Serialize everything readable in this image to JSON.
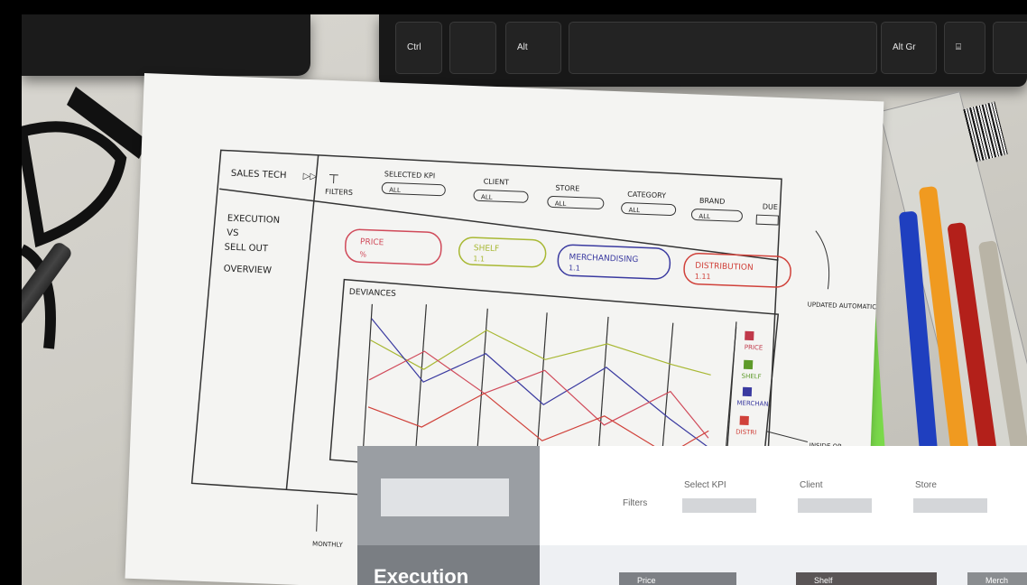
{
  "keyboard": {
    "keys": [
      "Ctrl",
      "Alt",
      "Alt Gr",
      "⌸"
    ]
  },
  "sketch": {
    "app_title": "SALES TECH",
    "filters_label": "FILTERS",
    "filters": [
      {
        "label": "SELECTED KPI",
        "value": "ALL"
      },
      {
        "label": "CLIENT",
        "value": "ALL"
      },
      {
        "label": "STORE",
        "value": "ALL"
      },
      {
        "label": "CATEGORY",
        "value": "ALL"
      },
      {
        "label": "BRAND",
        "value": "ALL"
      },
      {
        "label": "DUE",
        "value": ""
      }
    ],
    "nav": {
      "line1": "EXECUTION",
      "line2": "VS",
      "line3": "SELL OUT",
      "overview": "OVERVIEW"
    },
    "kpi_cards": [
      {
        "label": "PRICE",
        "sub": "%",
        "color": "#d04a5a"
      },
      {
        "label": "SHELF",
        "sub": "1.1",
        "color": "#a8b833"
      },
      {
        "label": "MERCHANDISING",
        "sub": "1.1",
        "color": "#3a3aa0"
      },
      {
        "label": "DISTRIBUTION",
        "sub": "1.11",
        "color": "#d0413a"
      }
    ],
    "chart_title": "DEVIANCES",
    "legend": [
      "PRICE",
      "SHELF",
      "MERCHAN",
      "DISTRI"
    ],
    "note_right": "UPDATED AUTOMATICALLY",
    "note_bottom_right": "INSIDE OR",
    "note_bottom": "MONTHLY"
  },
  "mockup": {
    "filters_label": "Filters",
    "filter_labels": [
      "Select KPI",
      "Client",
      "Store"
    ],
    "section_title": "Execution",
    "kpis": [
      {
        "label": "Price",
        "color": "#7d8085"
      },
      {
        "label": "Shelf",
        "color": "#5a5556"
      },
      {
        "label": "Merch",
        "color": "#8a8d90"
      }
    ]
  }
}
